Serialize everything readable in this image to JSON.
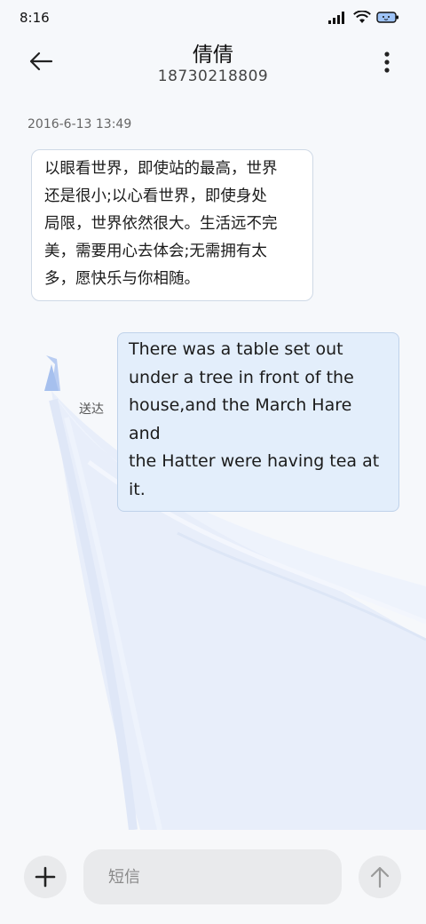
{
  "status_bar": {
    "time": "8:16"
  },
  "header": {
    "contact_name": "倩倩",
    "contact_number": "18730218809"
  },
  "conversation": {
    "timestamp": "2016-6-13 13:49",
    "incoming": {
      "lines": [
        "以眼看世界，即使站的最高，世界",
        "还是很小;以心看世界，即使身处",
        "局限，世界依然很大。生活远不完",
        "美，需要用心去体会;无需拥有太",
        "多，愿快乐与你相随。"
      ]
    },
    "outgoing": {
      "lines": [
        "There was a table set out",
        "under a tree in front of the",
        "house,and the March Hare and",
        "the Hatter were having tea at",
        "it."
      ],
      "status": "送达"
    }
  },
  "composer": {
    "placeholder": "短信"
  },
  "icons": {
    "back": "arrow-left-icon",
    "more": "more-vertical-icon",
    "add": "plus-icon",
    "send": "arrow-up-icon",
    "signal": "signal-icon",
    "wifi": "wifi-icon",
    "battery": "battery-icon"
  },
  "colors": {
    "outgoing_bubble": "#e3eefb",
    "background": "#f6f8fb"
  }
}
